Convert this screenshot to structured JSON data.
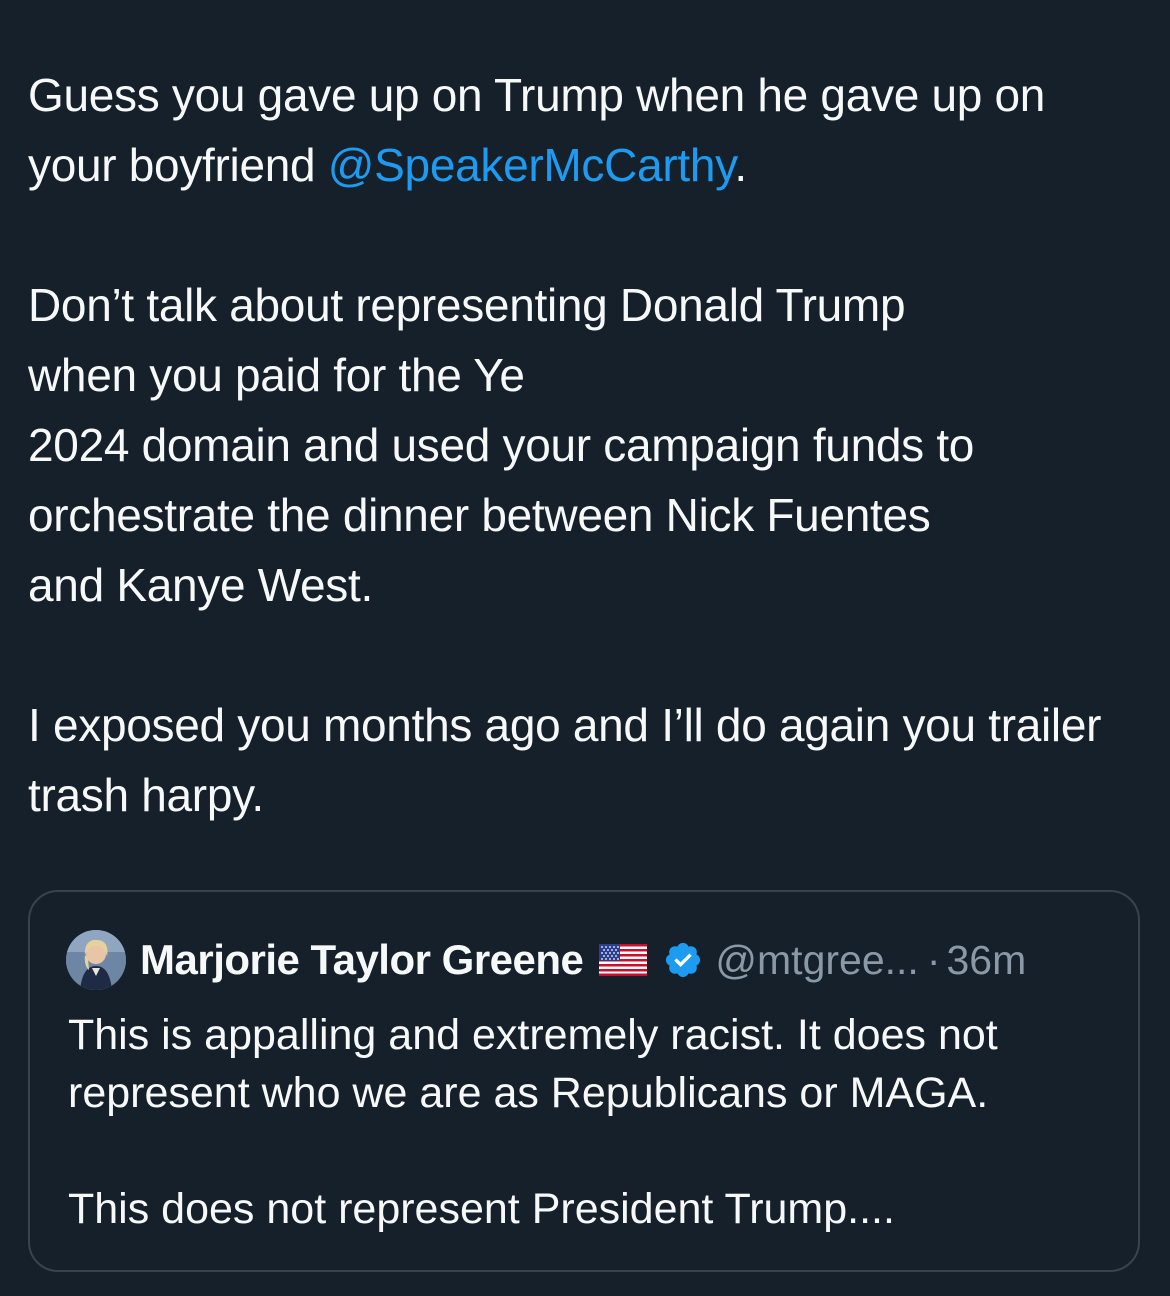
{
  "tweet": {
    "para1": {
      "before_mention": "Guess you gave up on Trump when he gave up on your boyfriend ",
      "mention": "@SpeakerMcCarthy",
      "after_mention": "."
    },
    "para2_lines": [
      "Don’t talk about representing Donald Trump",
      "when you paid for the Ye",
      "2024 domain and used your campaign funds to",
      "orchestrate the dinner between Nick Fuentes",
      "and Kanye West."
    ],
    "para3": "I exposed you months ago and I’ll do again you trailer trash harpy."
  },
  "quote": {
    "name": "Marjorie Taylor Greene",
    "flag_icon": "us-flag-icon",
    "verified_icon": "verified-badge-icon",
    "handle": "@mtgree...",
    "separator": "·",
    "time": "36m",
    "para1": "This is appalling and extremely racist.  It does not represent who we are as Republicans or MAGA.",
    "para2": "This does not represent President Trump...."
  },
  "colors": {
    "background": "#15202b",
    "text": "#f7f9f9",
    "link": "#1d9bf0",
    "secondary": "#8b98a5",
    "border": "#38444d",
    "verified": "#1d9bf0"
  }
}
